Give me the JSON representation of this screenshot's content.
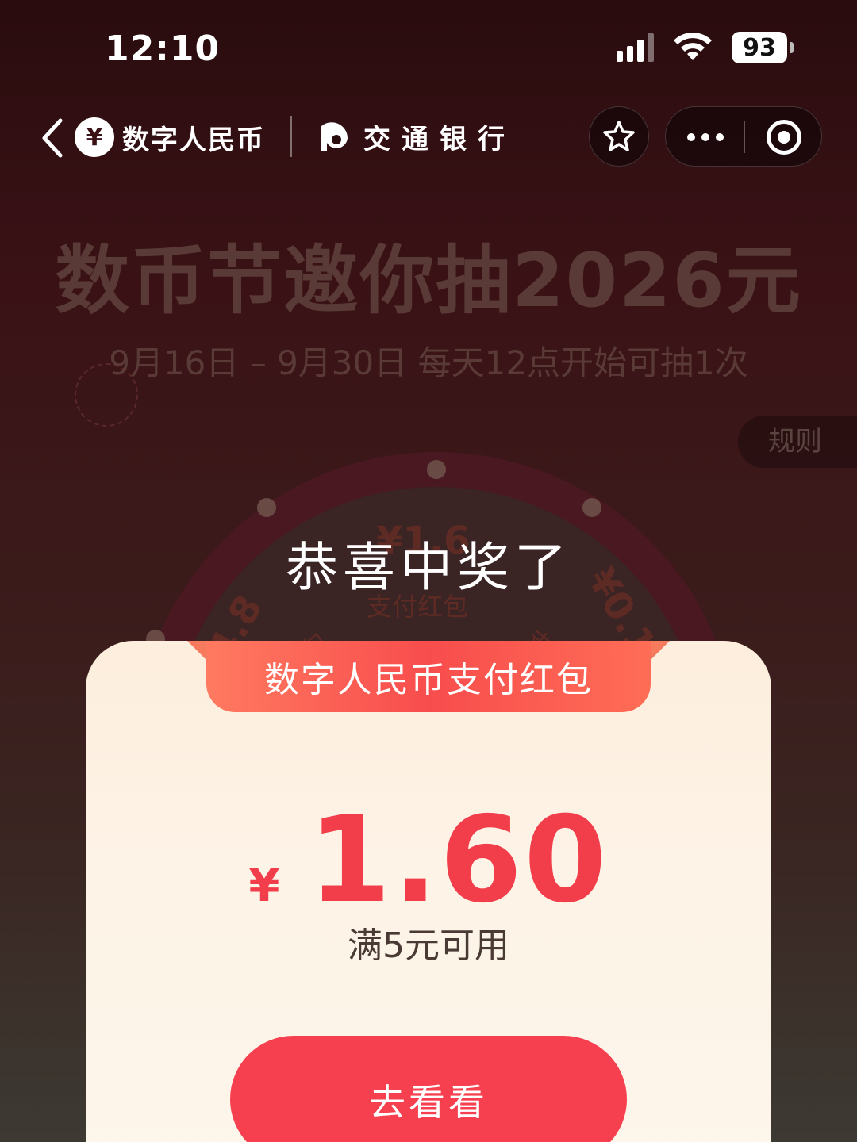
{
  "status_bar": {
    "time": "12:10",
    "battery": "93",
    "icons": [
      "signal-icon",
      "wifi-icon",
      "battery-icon"
    ]
  },
  "nav": {
    "brand_dcep": "数字人民币",
    "brand_bocom": "交通银行",
    "icons": [
      "back-icon",
      "star-icon",
      "more-icon",
      "target-icon"
    ]
  },
  "promo": {
    "title": "数币节邀你抽2026元",
    "subtitle": "9月16日 – 9月30日  每天12点开始可抽1次",
    "rules": "规则",
    "wheel": {
      "top_value": "¥1.6",
      "top_label": "支付红包",
      "left_value": "4.8",
      "left_label": "包",
      "right_value": "¥0.1",
      "right_label": "支"
    }
  },
  "modal": {
    "heading": "恭喜中奖了",
    "banner": "数字人民币支付红包",
    "currency": "¥",
    "amount": "1.60",
    "condition": "满5元可用",
    "button": "去看看"
  },
  "colors": {
    "accent": "#f23d4a",
    "button": "#f7404f",
    "card": "#fdf3e6",
    "banner": "#f84d4d"
  }
}
